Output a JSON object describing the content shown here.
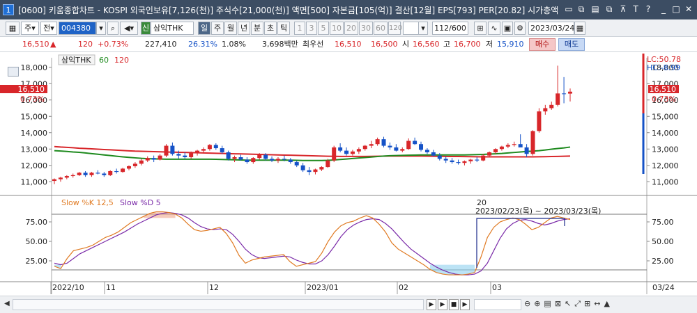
{
  "window": {
    "number": "1",
    "title": "[0600] 키움종합차트 - KOSPI 외국인보유[7,126(천)] 주식수[21,000(천)] 액면[500] 자본금[105(억)] 결산[12월] EPS[793] PER[20.82] 시가총액"
  },
  "toolbar": {
    "period_select": "주",
    "range_select": "전",
    "code": "004380",
    "stock_name_tag": "신",
    "stock_name": "삼익THK",
    "periods": [
      "일",
      "주",
      "월",
      "년",
      "분",
      "초",
      "틱"
    ],
    "minutes": [
      "1",
      "3",
      "5",
      "10",
      "20",
      "30",
      "60",
      "120"
    ],
    "count": "112/600",
    "date": "2023/03/24"
  },
  "quote": {
    "price": "16,510",
    "arrow": "▲",
    "change": "120",
    "change_rate": "+0.73%",
    "volume": "227,410",
    "turnover": "26.31%",
    "ratio": "1.08%",
    "amount": "3,698백만",
    "best_label": "최우선",
    "best_ask": "16,510",
    "best_bid": "16,500",
    "open_label": "시",
    "open": "16,560",
    "high_label": "고",
    "high": "16,700",
    "low_label": "저",
    "low": "15,910",
    "buy_label": "매수",
    "sell_label": "매도"
  },
  "price_panel": {
    "legend_name": "삼익THK",
    "ma1": "60",
    "ma2": "120",
    "y_ticks": [
      "18,000",
      "17,000",
      "16,000",
      "15,000",
      "14,000",
      "13,000",
      "12,000",
      "11,000"
    ],
    "left_price": "16,510",
    "left_pct": "0.73%",
    "right_price": "16,510",
    "right_pct": "0.73%",
    "lc": "LC:50.78",
    "hc": "HC:-8.99"
  },
  "stoch_panel": {
    "label_k": "Slow %K 12,5",
    "label_d": "Slow %D 5",
    "y_ticks": [
      "75.00",
      "50.00",
      "25.00"
    ],
    "annotation_count": "20",
    "annotation_range": "2023/02/23(목) ~ 2023/03/23(목)"
  },
  "x_axis": {
    "labels": [
      "2022/10",
      "11",
      "12",
      "2023/01",
      "02",
      "03"
    ],
    "right_label": "03/24"
  },
  "colors": {
    "up": "#d8262a",
    "down": "#1552c7",
    "ma60": "#1e8a1e",
    "ma120": "#d8262a",
    "slow_k": "#e07a22",
    "slow_d": "#7a2aa8"
  },
  "chart_data": {
    "type": "candlestick",
    "series": [
      {
        "name": "price",
        "ohlc": [
          [
            11050,
            11200,
            10850,
            11150
          ],
          [
            11150,
            11300,
            11000,
            11250
          ],
          [
            11250,
            11400,
            11150,
            11350
          ],
          [
            11350,
            11500,
            11250,
            11400
          ],
          [
            11400,
            11600,
            11350,
            11550
          ],
          [
            11550,
            11650,
            11300,
            11400
          ],
          [
            11400,
            11600,
            11300,
            11550
          ],
          [
            11550,
            11700,
            11450,
            11500
          ],
          [
            11500,
            11600,
            11300,
            11400
          ],
          [
            11400,
            11700,
            11350,
            11650
          ],
          [
            11650,
            11800,
            11500,
            11600
          ],
          [
            11600,
            11850,
            11550,
            11800
          ],
          [
            11800,
            12000,
            11700,
            11950
          ],
          [
            11950,
            12200,
            11850,
            12100
          ],
          [
            12100,
            12400,
            12000,
            12300
          ],
          [
            12300,
            12550,
            12200,
            12450
          ],
          [
            12450,
            12600,
            12200,
            12350
          ],
          [
            12350,
            12700,
            12300,
            12600
          ],
          [
            12600,
            13300,
            12500,
            13200
          ],
          [
            13200,
            13400,
            12600,
            12700
          ],
          [
            12700,
            12900,
            12400,
            12600
          ],
          [
            12600,
            12800,
            12400,
            12500
          ],
          [
            12500,
            12850,
            12400,
            12750
          ],
          [
            12750,
            12950,
            12600,
            12900
          ],
          [
            12900,
            13100,
            12800,
            13000
          ],
          [
            13000,
            13300,
            12900,
            13250
          ],
          [
            13250,
            13350,
            12950,
            13050
          ],
          [
            13050,
            13200,
            12700,
            12800
          ],
          [
            12800,
            12900,
            12300,
            12400
          ],
          [
            12400,
            12600,
            12200,
            12500
          ],
          [
            12500,
            12650,
            12300,
            12350
          ],
          [
            12350,
            12500,
            12100,
            12200
          ],
          [
            12200,
            12500,
            12100,
            12450
          ],
          [
            12450,
            12750,
            12350,
            12650
          ],
          [
            12650,
            12750,
            12300,
            12400
          ],
          [
            12400,
            12550,
            12200,
            12300
          ],
          [
            12300,
            12500,
            12150,
            12400
          ],
          [
            12400,
            12600,
            12250,
            12350
          ],
          [
            12350,
            12450,
            12100,
            12200
          ],
          [
            12200,
            12300,
            11900,
            12000
          ],
          [
            12000,
            12150,
            11600,
            11700
          ],
          [
            11700,
            11900,
            11400,
            11600
          ],
          [
            11600,
            11800,
            11450,
            11750
          ],
          [
            11750,
            11950,
            11650,
            11900
          ],
          [
            11900,
            12400,
            11850,
            12300
          ],
          [
            12300,
            13200,
            12200,
            13100
          ],
          [
            13100,
            13350,
            12800,
            12900
          ],
          [
            12900,
            13100,
            12600,
            12700
          ],
          [
            12700,
            12950,
            12600,
            12850
          ],
          [
            12850,
            13100,
            12700,
            13000
          ],
          [
            13000,
            13250,
            12900,
            13200
          ],
          [
            13200,
            13500,
            13050,
            13300
          ],
          [
            13300,
            13700,
            13200,
            13600
          ],
          [
            13600,
            13750,
            13100,
            13200
          ],
          [
            13200,
            13400,
            12950,
            13100
          ],
          [
            13100,
            13300,
            12850,
            12900
          ],
          [
            12900,
            13100,
            12800,
            13000
          ],
          [
            13000,
            13650,
            12950,
            13500
          ],
          [
            13500,
            13700,
            13250,
            13300
          ],
          [
            13300,
            13450,
            12850,
            12950
          ],
          [
            12950,
            13050,
            12700,
            12800
          ],
          [
            12800,
            12950,
            12550,
            12600
          ],
          [
            12600,
            12750,
            12300,
            12400
          ],
          [
            12400,
            12550,
            12150,
            12300
          ],
          [
            12300,
            12450,
            12100,
            12200
          ],
          [
            12200,
            12350,
            12050,
            12150
          ],
          [
            12150,
            12300,
            12000,
            12250
          ],
          [
            12250,
            12400,
            12100,
            12350
          ],
          [
            12350,
            12500,
            12200,
            12300
          ],
          [
            12300,
            12700,
            12250,
            12600
          ],
          [
            12600,
            12850,
            12500,
            12800
          ],
          [
            12800,
            13050,
            12700,
            13000
          ],
          [
            13000,
            13200,
            12900,
            13150
          ],
          [
            13150,
            13350,
            13050,
            13250
          ],
          [
            13250,
            13450,
            13150,
            13300
          ],
          [
            13300,
            13900,
            13200,
            13100
          ],
          [
            13100,
            13300,
            12500,
            12700
          ],
          [
            12700,
            14150,
            12600,
            14100
          ],
          [
            14100,
            15500,
            14000,
            15300
          ],
          [
            15300,
            15700,
            15100,
            15500
          ],
          [
            15500,
            15900,
            15400,
            15700
          ],
          [
            15700,
            18100,
            15600,
            16400
          ],
          [
            16400,
            17400,
            15800,
            16390
          ],
          [
            16390,
            16700,
            15910,
            16510
          ]
        ]
      },
      {
        "name": "60",
        "values": [
          12900,
          12880,
          12850,
          12820,
          12800,
          12760,
          12720,
          12680,
          12640,
          12600,
          12560,
          12520,
          12490,
          12460,
          12430,
          12410,
          12400,
          12390,
          12380,
          12380,
          12380,
          12380,
          12380,
          12380,
          12380,
          12380,
          12370,
          12360,
          12350,
          12340,
          12330,
          12320,
          12320,
          12320,
          12320,
          12320,
          12320,
          12320,
          12320,
          12310,
          12300,
          12300,
          12300,
          12300,
          12310,
          12330,
          12360,
          12390,
          12420,
          12450,
          12480,
          12510,
          12540,
          12570,
          12590,
          12600,
          12610,
          12620,
          12630,
          12640,
          12640,
          12640,
          12640,
          12640,
          12640,
          12640,
          12640,
          12650,
          12660,
          12670,
          12690,
          12710,
          12730,
          12760,
          12790,
          12820,
          12850,
          12870,
          12900,
          12940,
          12990,
          13030,
          13070,
          13120
        ]
      },
      {
        "name": "120",
        "values": [
          13150,
          13120,
          13100,
          13080,
          13050,
          13030,
          13010,
          12990,
          12970,
          12950,
          12930,
          12910,
          12890,
          12870,
          12860,
          12850,
          12840,
          12830,
          12820,
          12810,
          12800,
          12790,
          12780,
          12770,
          12760,
          12750,
          12740,
          12730,
          12720,
          12710,
          12700,
          12690,
          12680,
          12670,
          12660,
          12650,
          12640,
          12630,
          12620,
          12610,
          12600,
          12590,
          12580,
          12570,
          12560,
          12555,
          12550,
          12550,
          12550,
          12550,
          12550,
          12555,
          12560,
          12565,
          12570,
          12570,
          12570,
          12570,
          12570,
          12570,
          12565,
          12560,
          12555,
          12550,
          12545,
          12540,
          12535,
          12530,
          12525,
          12520,
          12520,
          12520,
          12520,
          12520,
          12520,
          12520,
          12520,
          12520,
          12525,
          12530,
          12540,
          12550,
          12560,
          12570
        ]
      },
      {
        "name": "Slow %K 12,5",
        "values": [
          18,
          15,
          28,
          38,
          40,
          42,
          45,
          50,
          55,
          58,
          62,
          68,
          74,
          78,
          82,
          86,
          88,
          88,
          87,
          85,
          80,
          72,
          65,
          63,
          64,
          66,
          68,
          60,
          48,
          32,
          22,
          26,
          28,
          30,
          31,
          32,
          33,
          24,
          18,
          20,
          22,
          24,
          35,
          50,
          62,
          70,
          74,
          76,
          80,
          83,
          80,
          72,
          62,
          48,
          40,
          35,
          30,
          25,
          20,
          14,
          10,
          8,
          7,
          7,
          7,
          8,
          10,
          30,
          55,
          68,
          75,
          78,
          80,
          78,
          72,
          65,
          68,
          74,
          80,
          82,
          80,
          78
        ]
      },
      {
        "name": "Slow %D 5",
        "values": [
          22,
          20,
          22,
          28,
          34,
          38,
          42,
          46,
          50,
          54,
          58,
          62,
          67,
          72,
          76,
          80,
          84,
          86,
          87,
          86,
          84,
          80,
          74,
          69,
          66,
          65,
          66,
          65,
          59,
          50,
          40,
          33,
          29,
          28,
          29,
          30,
          31,
          30,
          26,
          23,
          21,
          21,
          25,
          33,
          44,
          56,
          65,
          71,
          75,
          78,
          79,
          78,
          73,
          66,
          57,
          48,
          40,
          34,
          28,
          22,
          17,
          13,
          10,
          8,
          7,
          7,
          8,
          12,
          22,
          38,
          54,
          66,
          73,
          77,
          78,
          76,
          73,
          71,
          73,
          76,
          78,
          79
        ]
      }
    ],
    "ylim": [
      10500,
      18500
    ],
    "stoch_ylim": [
      0,
      100
    ],
    "grid": false
  }
}
